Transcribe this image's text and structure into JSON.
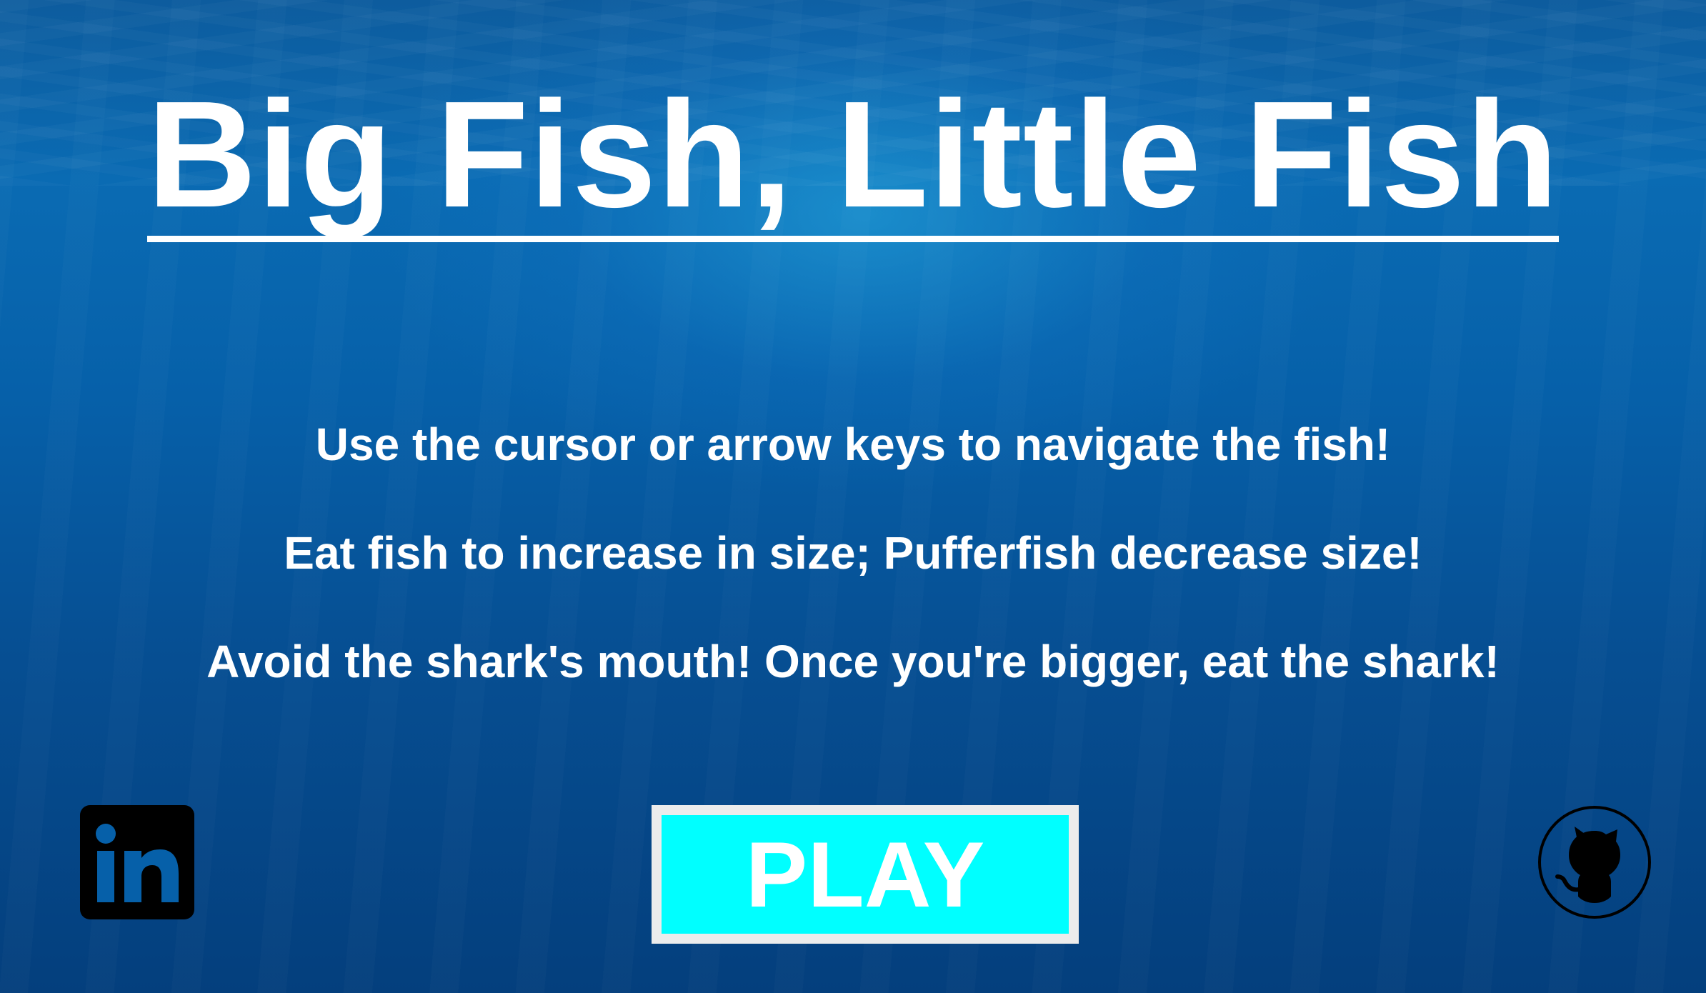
{
  "title": "Big Fish, Little Fish",
  "instructions": [
    "Use the cursor or arrow keys to navigate the fish!",
    "Eat fish to increase in size; Pufferfish decrease size!",
    "Avoid the shark's mouth! Once you're bigger, eat the shark!"
  ],
  "play_button": {
    "label": "PLAY",
    "color": "#00ffff"
  },
  "social": {
    "linkedin_icon": "linkedin-icon",
    "github_icon": "github-icon"
  },
  "colors": {
    "background": "#0660a9",
    "text": "#ffffff"
  }
}
